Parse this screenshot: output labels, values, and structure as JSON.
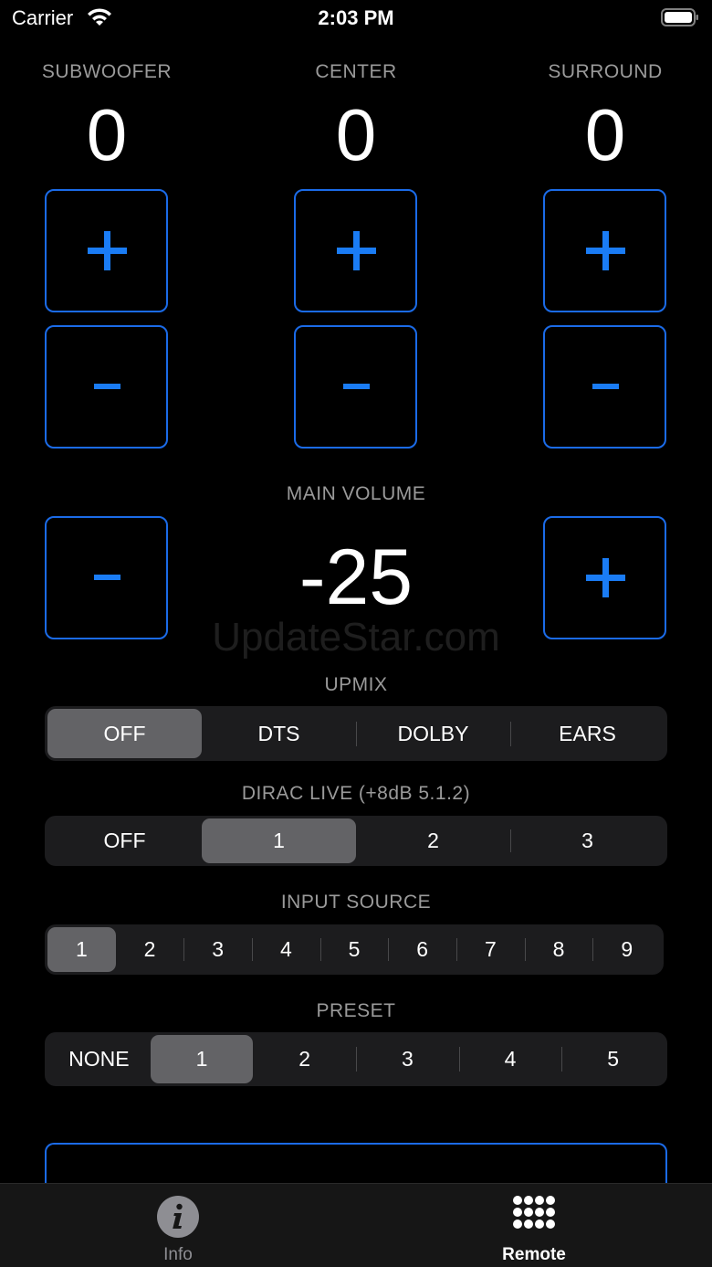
{
  "status_bar": {
    "carrier": "Carrier",
    "time": "2:03 PM",
    "wifi_icon": "wifi-icon",
    "battery_icon": "battery-icon"
  },
  "channels": [
    {
      "label": "SUBWOOFER",
      "value": "0"
    },
    {
      "label": "CENTER",
      "value": "0"
    },
    {
      "label": "SURROUND",
      "value": "0"
    }
  ],
  "main_volume": {
    "label": "MAIN VOLUME",
    "value": "-25"
  },
  "watermark": "UpdateStar.com",
  "upmix": {
    "label": "UPMIX",
    "options": [
      "OFF",
      "DTS",
      "DOLBY",
      "EARS"
    ],
    "selected": "OFF"
  },
  "dirac": {
    "label": "DIRAC LIVE (+8dB 5.1.2)",
    "options": [
      "OFF",
      "1",
      "2",
      "3"
    ],
    "selected": "1"
  },
  "input_source": {
    "label": "INPUT SOURCE",
    "options": [
      "1",
      "2",
      "3",
      "4",
      "5",
      "6",
      "7",
      "8",
      "9"
    ],
    "selected": "1"
  },
  "preset": {
    "label": "PRESET",
    "options": [
      "NONE",
      "1",
      "2",
      "3",
      "4",
      "5"
    ],
    "selected": "1"
  },
  "tabs": [
    {
      "label": "Info",
      "icon": "info-icon",
      "active": false
    },
    {
      "label": "Remote",
      "icon": "grid-dots-icon",
      "active": true
    }
  ],
  "colors": {
    "accent": "#1b6be8",
    "plus_minus": "#1a7cf5",
    "segment_bg": "#1c1c1e",
    "segment_selected": "#636366",
    "label_gray": "#9a9a9a"
  }
}
